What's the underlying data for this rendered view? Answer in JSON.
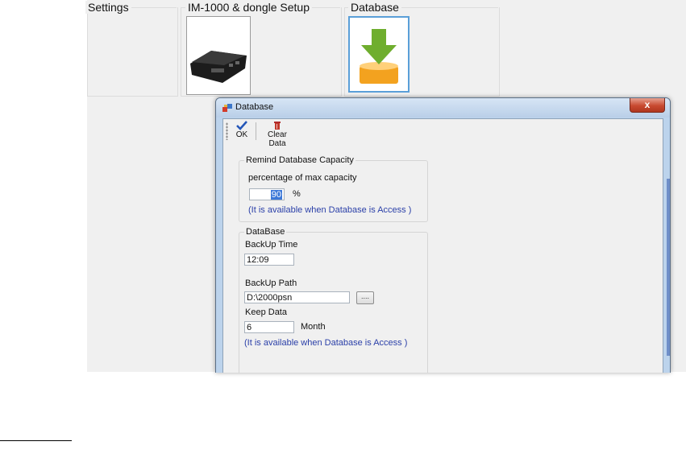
{
  "groups": {
    "settings_title": "Settings",
    "dongle_title": "IM-1000 & dongle Setup",
    "database_title": "Database"
  },
  "dialog": {
    "title": "Database",
    "close_label": "x",
    "toolbar": {
      "ok_label": "OK",
      "clear_label": "Clear Data"
    },
    "remind": {
      "legend": "Remind Database Capacity",
      "percentage_label": "percentage of max capacity",
      "percentage_value": "90",
      "percent_sign": "%",
      "note": "(It is available when Database is Access )"
    },
    "database": {
      "legend": "DataBase",
      "backup_time_label": "BackUp Time",
      "backup_time_value": "12:09",
      "backup_path_label": "BackUp Path",
      "backup_path_value": "D:\\2000psn",
      "browse_label": "....",
      "keep_data_label": "Keep Data",
      "keep_data_value": "6",
      "month_label": "Month",
      "note": "(It is available when Database is Access )"
    }
  },
  "colors": {
    "accent": "#2a3fa8",
    "download_arrow": "#6fae2e",
    "tray": "#f3a21f"
  }
}
